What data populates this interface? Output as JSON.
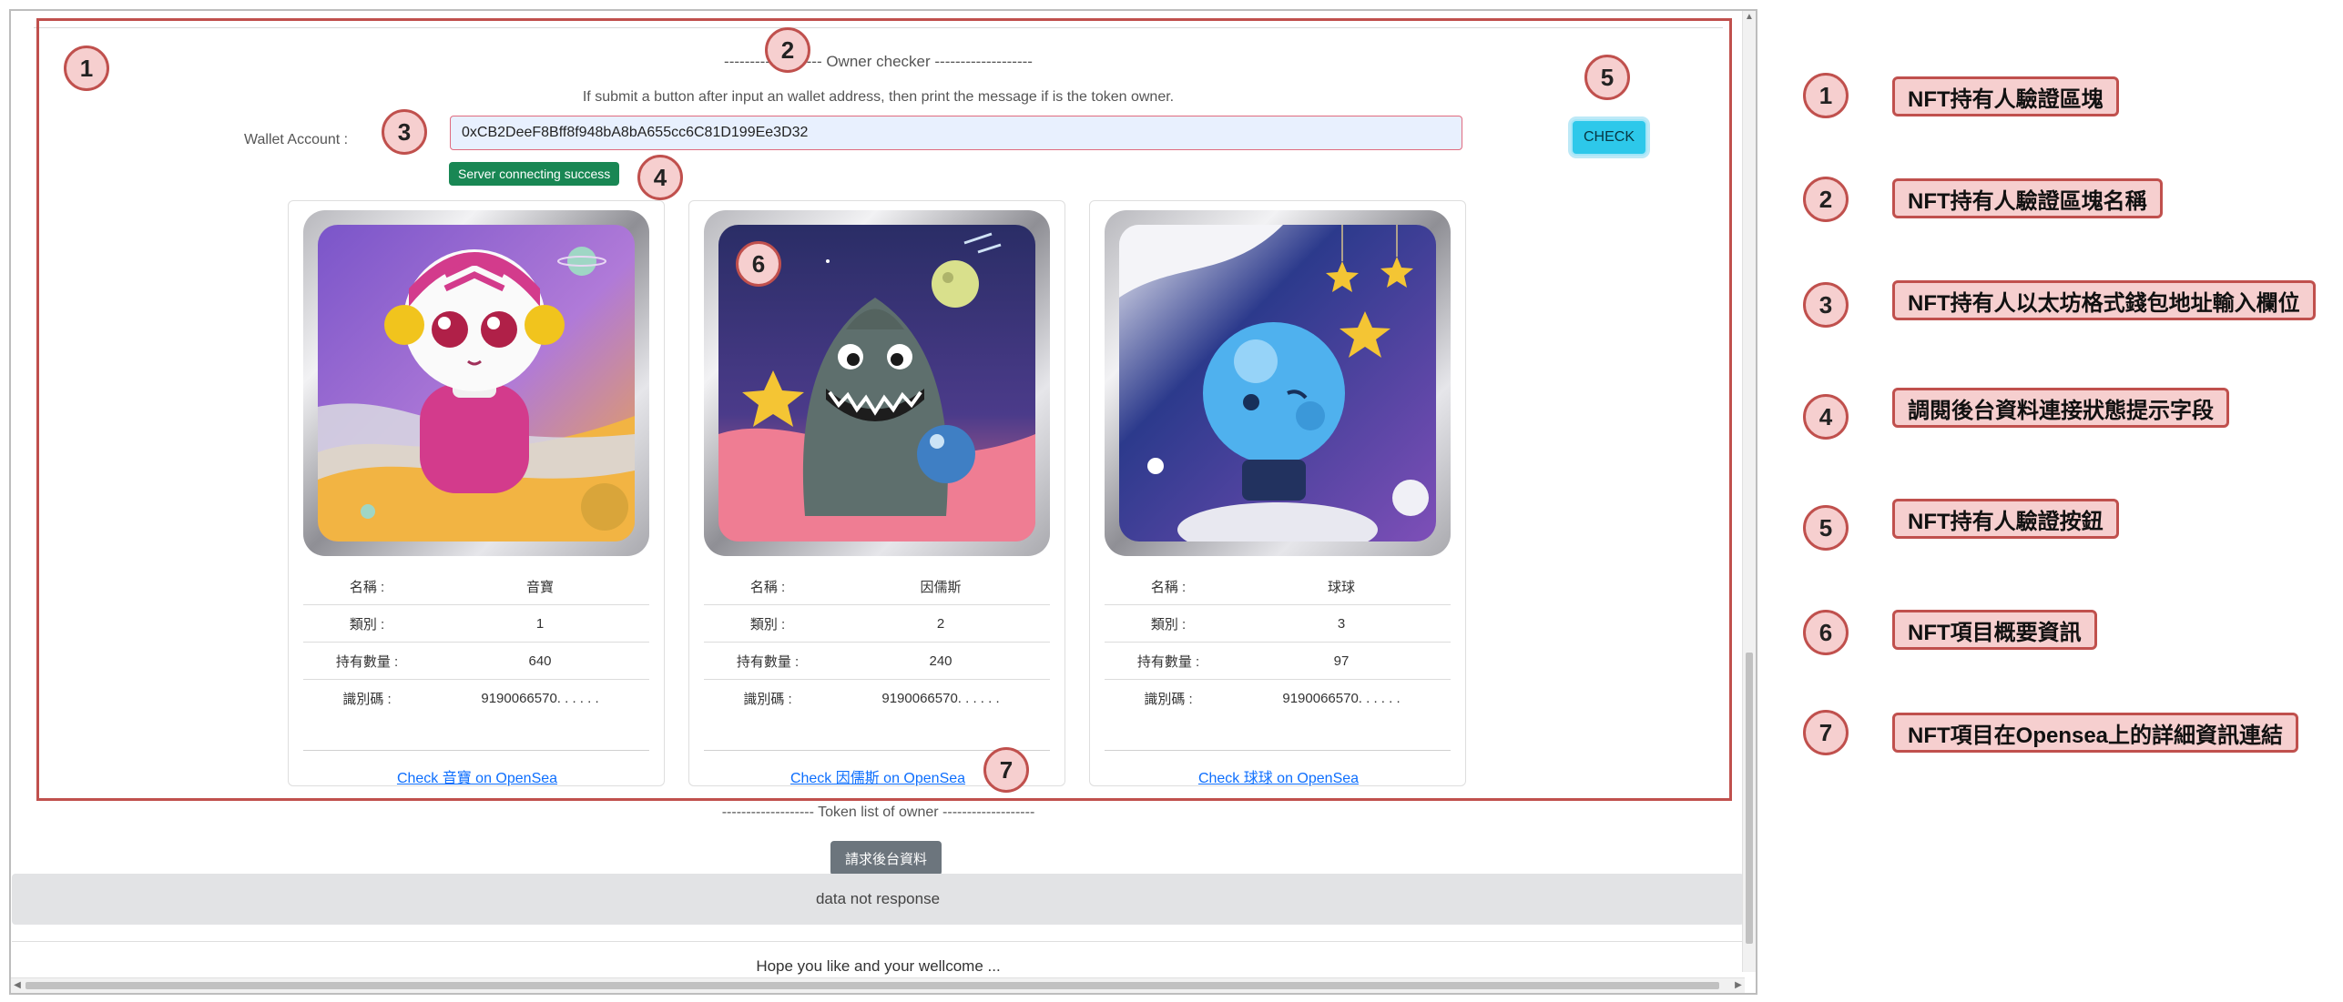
{
  "owner_checker": {
    "title": "------------------- Owner checker -------------------",
    "description": "If submit a button after input an wallet address, then print the message if is the token owner.",
    "wallet_label": "Wallet Account :",
    "wallet_value": "0xCB2DeeF8Bff8f948bA8bA655cc6C81D199Ee3D32",
    "check_label": "CHECK",
    "status": "Server connecting success",
    "status_color": "#198754"
  },
  "cards": [
    {
      "name_key": "名稱 :",
      "name": "音寶",
      "type_key": "類別 :",
      "type": "1",
      "qty_key": "持有數量 :",
      "qty": "640",
      "id_key": "識別碼 :",
      "id": "9190066570. . . . . .",
      "link": "Check 音寶 on OpenSea"
    },
    {
      "name_key": "名稱 :",
      "name": "因儒斯",
      "type_key": "類別 :",
      "type": "2",
      "qty_key": "持有數量 :",
      "qty": "240",
      "id_key": "識別碼 :",
      "id": "9190066570. . . . . .",
      "link": "Check 因儒斯 on OpenSea"
    },
    {
      "name_key": "名稱 :",
      "name": "球球",
      "type_key": "類別 :",
      "type": "3",
      "qty_key": "持有數量 :",
      "qty": "97",
      "id_key": "識別碼 :",
      "id": "9190066570. . . . . .",
      "link": "Check 球球 on OpenSea"
    }
  ],
  "token_list": {
    "title": "------------------- Token list of owner -------------------",
    "request_label": "請求後台資料",
    "no_response": "data not response"
  },
  "footer": {
    "text": "Hope you like and your wellcome ..."
  },
  "markers": [
    "1",
    "2",
    "3",
    "4",
    "5",
    "6",
    "7"
  ],
  "legend": [
    {
      "num": "1",
      "label": "NFT持有人驗證區塊"
    },
    {
      "num": "2",
      "label": "NFT持有人驗證區塊名稱"
    },
    {
      "num": "3",
      "label": "NFT持有人以太坊格式錢包地址輸入欄位"
    },
    {
      "num": "4",
      "label": "調閱後台資料連接狀態提示字段"
    },
    {
      "num": "5",
      "label": "NFT持有人驗證按鈕"
    },
    {
      "num": "6",
      "label": "NFT項目概要資訊"
    },
    {
      "num": "7",
      "label": "NFT項目在Opensea上的詳細資訊連結"
    }
  ],
  "colors": {
    "annotation_border": "#c0504d",
    "annotation_fill": "#f6cfcf",
    "check_button": "#2dc8ea",
    "link": "#0d6efd"
  }
}
